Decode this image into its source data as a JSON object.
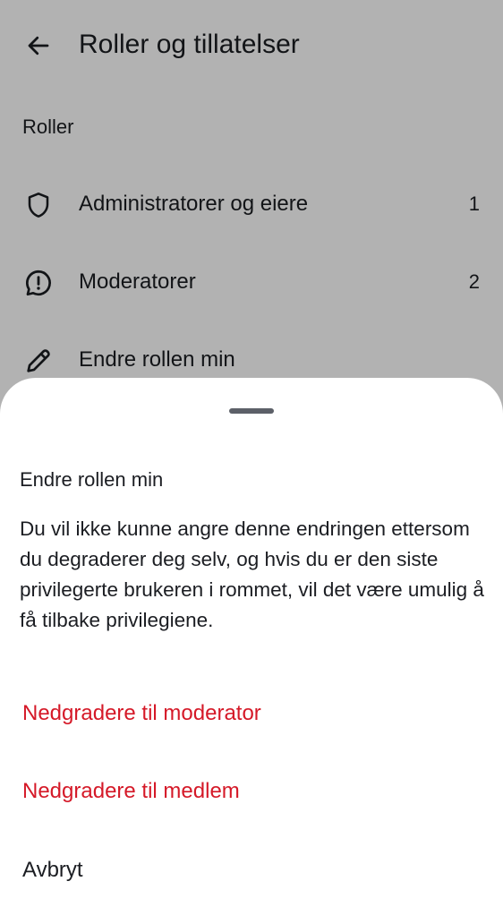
{
  "header": {
    "title": "Roller og tillatelser",
    "back_icon": "arrow-left-icon"
  },
  "roles_section": {
    "title": "Roller",
    "items": [
      {
        "label": "Administratorer og eiere",
        "count": "1",
        "icon": "shield-icon"
      },
      {
        "label": "Moderatorer",
        "count": "2",
        "icon": "chat-alert-icon"
      },
      {
        "label": "Endre rollen min",
        "count": "",
        "icon": "pencil-icon"
      }
    ]
  },
  "sheet": {
    "title": "Endre rollen min",
    "body": "Du vil ikke kunne angre denne endringen ettersom du degraderer deg selv, og hvis du er den siste privilegerte brukeren i rommet, vil det være umulig å få tilbake privilegiene.",
    "actions": [
      {
        "label": "Nedgradere til moderator",
        "style": "danger"
      },
      {
        "label": "Nedgradere til medlem",
        "style": "danger"
      },
      {
        "label": "Avbryt",
        "style": "plain"
      }
    ]
  },
  "colors": {
    "danger": "#d51928",
    "text": "#1b1d22",
    "scrim": "rgba(0,0,0,0.30)"
  }
}
